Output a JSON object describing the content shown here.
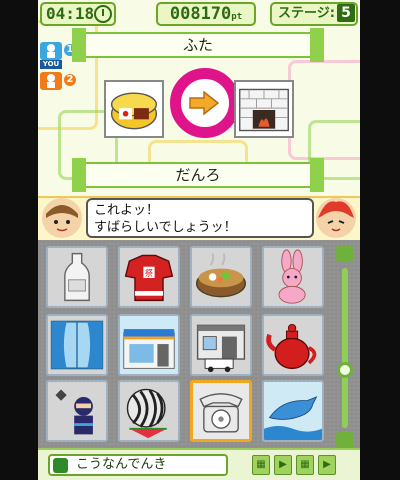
{
  "hud": {
    "time": "04:18",
    "score": "008170",
    "score_unit": "pt",
    "stage_label": "ステージ:",
    "stage_number": "5"
  },
  "players": {
    "p1_number": "1",
    "p1_tag": "YOU",
    "p2_number": "2"
  },
  "chain": {
    "previous_word": "ふた",
    "current_word": "だんろ"
  },
  "speech": {
    "line1": "これよッ！",
    "line2": "すばらしいでしょうッ！"
  },
  "picture_grid": {
    "tiles": [
      "bottle",
      "happi-coat",
      "hot-pot",
      "rabbit-plush",
      "window-curtain",
      "convenience-store",
      "police-box",
      "teapot",
      "ninja",
      "watermelon",
      "telephone",
      "dolphin"
    ],
    "selected": "telephone"
  },
  "footer": {
    "word_value": "こうなんでんき"
  },
  "colors": {
    "accent_green": "#6aa52a",
    "link_ring": "#e0148a",
    "selection": "#f1a81e"
  }
}
